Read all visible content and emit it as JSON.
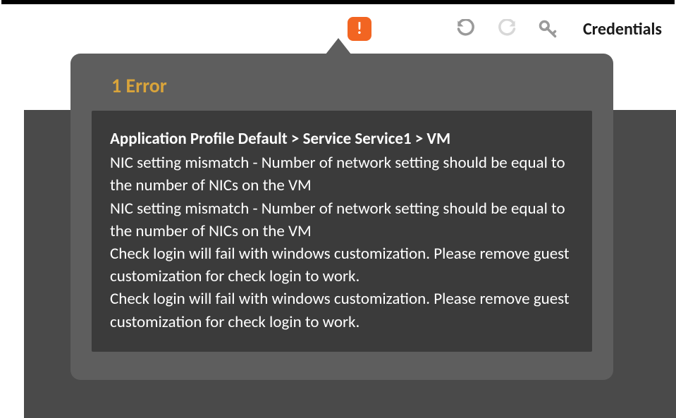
{
  "toolbar": {
    "alert_glyph": "!",
    "credentials_label": "Credentials"
  },
  "popover": {
    "title": "1 Error",
    "breadcrumb": "Application Profile Default > Service Service1 > VM",
    "messages": [
      "NIC setting mismatch - Number of network setting should be equal to the number of NICs on the VM",
      "NIC setting mismatch - Number of network setting should be equal to the number of NICs on the VM",
      "Check login will fail with windows customization. Please remove guest customization for check login to work.",
      "Check login will fail with windows customization. Please remove guest customization for check login to work."
    ]
  }
}
